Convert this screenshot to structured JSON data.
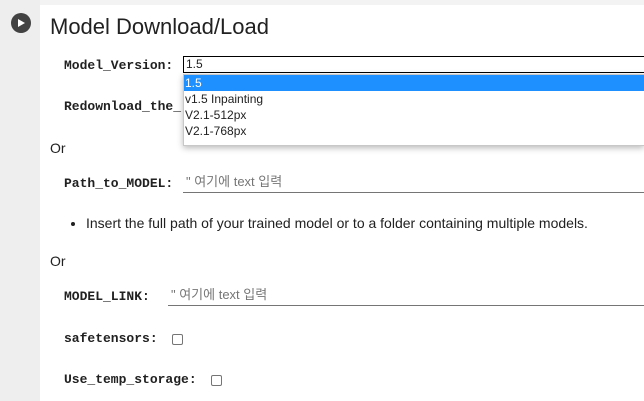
{
  "cell": {
    "title": "Model Download/Load",
    "or_label": "Or"
  },
  "model_version": {
    "label": "Model_Version:",
    "selected": "1.5",
    "options": [
      "1.5",
      "v1.5 Inpainting",
      "V2.1-512px",
      "V2.1-768px"
    ]
  },
  "redownload": {
    "label": "Redownload_the_"
  },
  "path_to_model": {
    "label": "Path_to_MODEL:",
    "placeholder": "\" 여기에 text 입력"
  },
  "help_bullet": "Insert the full path of your trained model or to a folder containing multiple models.",
  "model_link": {
    "label": "MODEL_LINK:",
    "placeholder": "\" 여기에 text 입력"
  },
  "safetensors": {
    "label": "safetensors:"
  },
  "use_temp_storage": {
    "label": "Use_temp_storage:"
  },
  "colors": {
    "selected_option_bg": "#1e90ff",
    "gutter_bg": "#eeeeee",
    "run_button": "#424242"
  }
}
